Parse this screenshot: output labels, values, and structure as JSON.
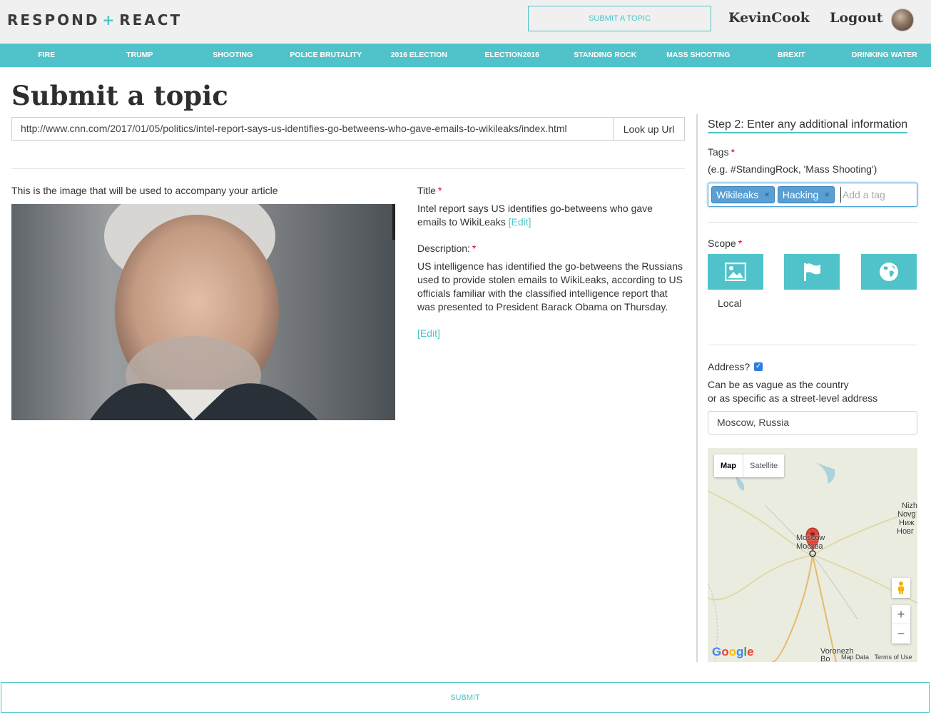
{
  "brand": {
    "left": "RESPOND",
    "plus": "+",
    "right": "REACT"
  },
  "header": {
    "submit_topic_label": "SUBMIT A TOPIC",
    "username": "KevinCook",
    "logout_label": "Logout"
  },
  "nav": {
    "items": [
      "FIRE",
      "TRUMP",
      "SHOOTING",
      "POLICE BRUTALITY",
      "2016 ELECTION",
      "ELECTION2016",
      "STANDING ROCK",
      "MASS SHOOTING",
      "BREXIT",
      "DRINKING WATER"
    ]
  },
  "page": {
    "title": "Submit a topic"
  },
  "lookup": {
    "url_value": "http://www.cnn.com/2017/01/05/politics/intel-report-says-us-identifies-go-betweens-who-gave-emails-to-wikileaks/index.html",
    "button_label": "Look up Url"
  },
  "article": {
    "image_caption": "This is the image that will be used to accompany your article",
    "title_label": "Title",
    "required_mark": "*",
    "title_text": "Intel report says US identifies go-betweens who gave emails to WikiLeaks",
    "edit_label": "[Edit]",
    "description_label": "Description:",
    "description_text": "US intelligence has identified the go-betweens the Russians used to provide stolen emails to WikiLeaks, according to US officials familiar with the classified intelligence report that was presented to President Barack Obama on Thursday."
  },
  "step2": {
    "heading": "Step 2: Enter any additional information",
    "tags_label": "Tags",
    "tags_hint": "(e.g. #StandingRock, 'Mass Shooting')",
    "tags": [
      "Wikileaks",
      "Hacking"
    ],
    "tag_remove_glyph": "×",
    "tag_placeholder": "Add a tag",
    "scope_label": "Scope",
    "scope_options": [
      {
        "icon": "image-icon",
        "label": "Local"
      },
      {
        "icon": "flag-icon",
        "label": ""
      },
      {
        "icon": "globe-icon",
        "label": ""
      }
    ],
    "address_label": "Address?",
    "address_checked": true,
    "address_help_line1": "Can be as vague as the country",
    "address_help_line2": "or as specific as a street-level address",
    "address_value": "Moscow, Russia"
  },
  "map": {
    "type_map": "Map",
    "type_satellite": "Satellite",
    "city_label_en": "Moscow",
    "city_label_ru": "Москва",
    "label_nizh": "Nizh",
    "label_novg": "Novg",
    "label_nizh_ru": "Ниж",
    "label_novg_ru": "Новг",
    "label_voronezh": "Voronezh",
    "label_voronezh_ru": "Во",
    "map_data": "Map Data",
    "terms": "Terms of Use",
    "zoom_in": "+",
    "zoom_out": "−"
  },
  "footer": {
    "submit_label": "SUBMIT"
  },
  "colors": {
    "accent": "#4fc3c9",
    "tag_chip": "#5a9fd4",
    "required": "#d0021b"
  }
}
